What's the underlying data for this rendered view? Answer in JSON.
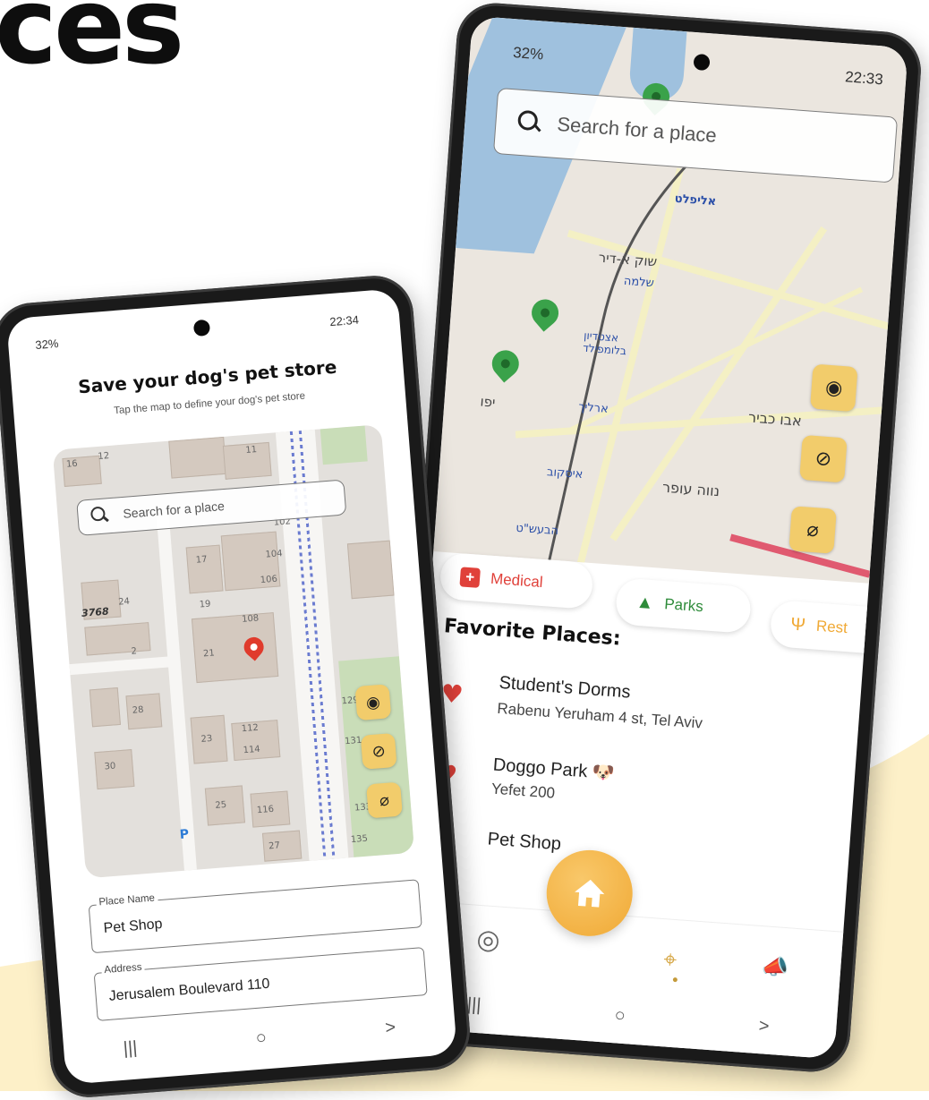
{
  "hero": {
    "title": "ces"
  },
  "colors": {
    "accent": "#f2cc6b",
    "pin": "#e03b2c",
    "park_pin": "#3aa24a",
    "heart": "#e0413a",
    "background_wave": "#fdf0c8"
  },
  "left_phone": {
    "status": {
      "battery": "32%",
      "time": "22:34"
    },
    "title": "Save your dog's pet store",
    "subtitle": "Tap the map to define your dog's pet store",
    "search_placeholder": "Search for a place",
    "map_labels": [
      "16",
      "12",
      "11",
      "102",
      "104",
      "106",
      "3768",
      "24",
      "19",
      "108",
      "17",
      "21",
      "23",
      "112",
      "114",
      "25",
      "116",
      "27",
      "2",
      "30",
      "28",
      "129",
      "131",
      "133",
      "135",
      "P"
    ],
    "map_buttons": [
      "target-icon",
      "compass-icon",
      "location-off-icon"
    ],
    "fields": [
      {
        "label": "Place Name",
        "value": "Pet Shop"
      },
      {
        "label": "Address",
        "value": "Jerusalem Boulevard 110"
      }
    ],
    "nav": [
      "|||",
      "○",
      ">"
    ]
  },
  "right_phone": {
    "status": {
      "battery": "32%",
      "time": "22:33"
    },
    "search_placeholder": "Search for a place",
    "map_labels": [
      "אליפלט",
      "שוק א-דיר",
      "שלמה",
      "אצטדיון בלומפילד",
      "יפו",
      "ארליך",
      "איסקוב",
      "נווה עופר",
      "אבו כביר",
      "הבעש\"ט"
    ],
    "map_buttons": [
      "target-icon",
      "compass-icon",
      "location-off-icon"
    ],
    "categories": [
      {
        "label": "Medical",
        "icon": "medical-cross-icon",
        "color": "#e0413a"
      },
      {
        "label": "Parks",
        "icon": "tree-icon",
        "color": "#2e8b3a"
      },
      {
        "label": "Rest",
        "icon": "fork-knife-icon",
        "color": "#f0a935"
      }
    ],
    "favorites_title": "Favorite Places:",
    "favorites": [
      {
        "name": "Student's Dorms",
        "address": "Rabenu Yeruham 4 st, Tel Aviv"
      },
      {
        "name": "Doggo Park 🐶",
        "address": "Yefet 200"
      },
      {
        "name": "Pet Shop",
        "address": ""
      }
    ],
    "tabs": [
      "target-tab-icon",
      "home-icon",
      "map-pin-tab-icon",
      "megaphone-tab-icon"
    ],
    "nav": [
      "|||",
      "○",
      ">"
    ]
  }
}
